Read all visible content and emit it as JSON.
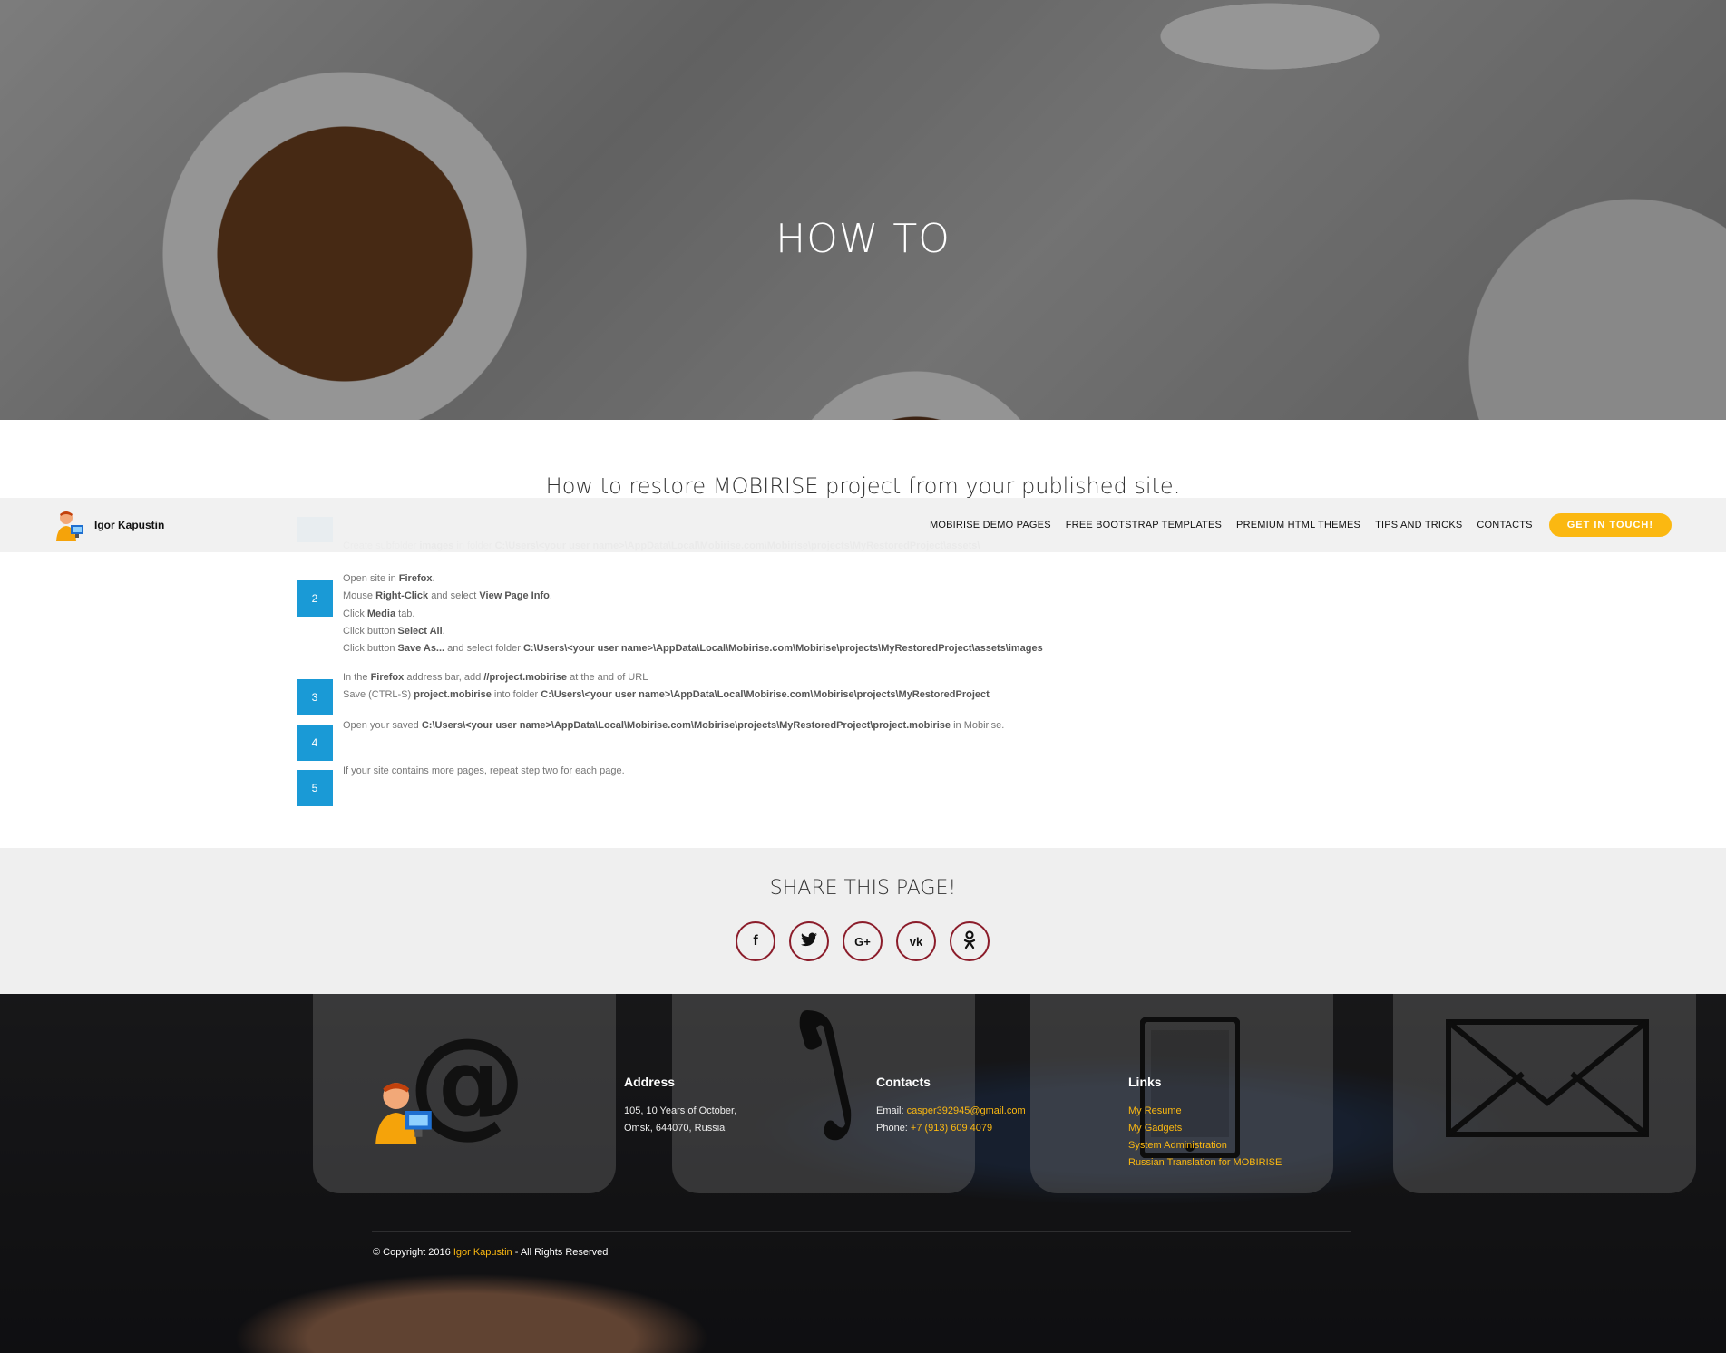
{
  "hero": {
    "title": "HOW TO"
  },
  "subtitle": "How to restore MOBIRISE project from your published site.",
  "navbar": {
    "brand": "Igor Kapustin",
    "links": [
      "MOBIRISE DEMO PAGES",
      "FREE BOOTSTRAP TEMPLATES",
      "PREMIUM HTML THEMES",
      "TIPS AND TRICKS",
      "CONTACTS"
    ],
    "cta": "GET IN TOUCH!"
  },
  "steps": [
    {
      "number": "",
      "lines": [
        [
          "Create subfolder ",
          {
            "b": "images"
          },
          " in folder ",
          {
            "b": "C:\\Users\\<your user name>\\AppData\\Local\\Mobirise.com\\Mobirise\\projects\\MyRestoredProject\\assets\\"
          }
        ]
      ]
    },
    {
      "number": "2",
      "lines": [
        [
          "Open site in ",
          {
            "b": "Firefox"
          },
          "."
        ],
        [
          "Mouse ",
          {
            "b": "Right-Click"
          },
          " and select ",
          {
            "b": "View Page Info"
          },
          "."
        ],
        [
          "Click ",
          {
            "b": "Media"
          },
          " tab."
        ],
        [
          "Click button ",
          {
            "b": "Select All"
          },
          "."
        ],
        [
          "Click button ",
          {
            "b": "Save As..."
          },
          " and select folder ",
          {
            "b": "C:\\Users\\<your user name>\\AppData\\Local\\Mobirise.com\\Mobirise\\projects\\MyRestoredProject\\assets\\images"
          }
        ]
      ]
    },
    {
      "number": "3",
      "lines": [
        [
          "In the ",
          {
            "b": "Firefox"
          },
          " address bar, add ",
          {
            "b": "//project.mobirise"
          },
          " at the and of URL"
        ],
        [
          "Save (CTRL-S) ",
          {
            "b": "project.mobirise"
          },
          " into folder ",
          {
            "b": "C:\\Users\\<your user name>\\AppData\\Local\\Mobirise.com\\Mobirise\\projects\\MyRestoredProject"
          }
        ]
      ]
    },
    {
      "number": "4",
      "lines": [
        [
          "Open your saved ",
          {
            "b": "C:\\Users\\<your user name>\\AppData\\Local\\Mobirise.com\\Mobirise\\projects\\MyRestoredProject\\project.mobirise"
          },
          " in Mobirise."
        ]
      ]
    },
    {
      "number": "5",
      "lines": [
        [
          "If your site contains more pages, repeat step two for each page."
        ]
      ]
    }
  ],
  "share": {
    "title": "SHARE THIS PAGE!",
    "buttons": [
      {
        "name": "facebook-icon",
        "glyph": "f"
      },
      {
        "name": "twitter-icon",
        "glyph": "🐦"
      },
      {
        "name": "google-plus-icon",
        "glyph": "G+"
      },
      {
        "name": "vk-icon",
        "glyph": "vk"
      },
      {
        "name": "odnoklassniki-icon",
        "glyph": "ok"
      }
    ]
  },
  "footer": {
    "address": {
      "heading": "Address",
      "lines": [
        "105, 10 Years of October,",
        "Omsk, 644070, Russia"
      ]
    },
    "contacts": {
      "heading": "Contacts",
      "email_label": "Email: ",
      "email": "casper392945@gmail.com",
      "phone_label": "Phone: ",
      "phone": "+7 (913) 609 4079"
    },
    "links": {
      "heading": "Links",
      "items": [
        "My Resume",
        "My Gadgets",
        "System Administration",
        "Russian Translation for MOBIRISE"
      ]
    },
    "copyright_prefix": "© Copyright 2016 ",
    "copyright_name": "Igor Kapustin",
    "copyright_suffix": " - All Rights Reserved"
  }
}
